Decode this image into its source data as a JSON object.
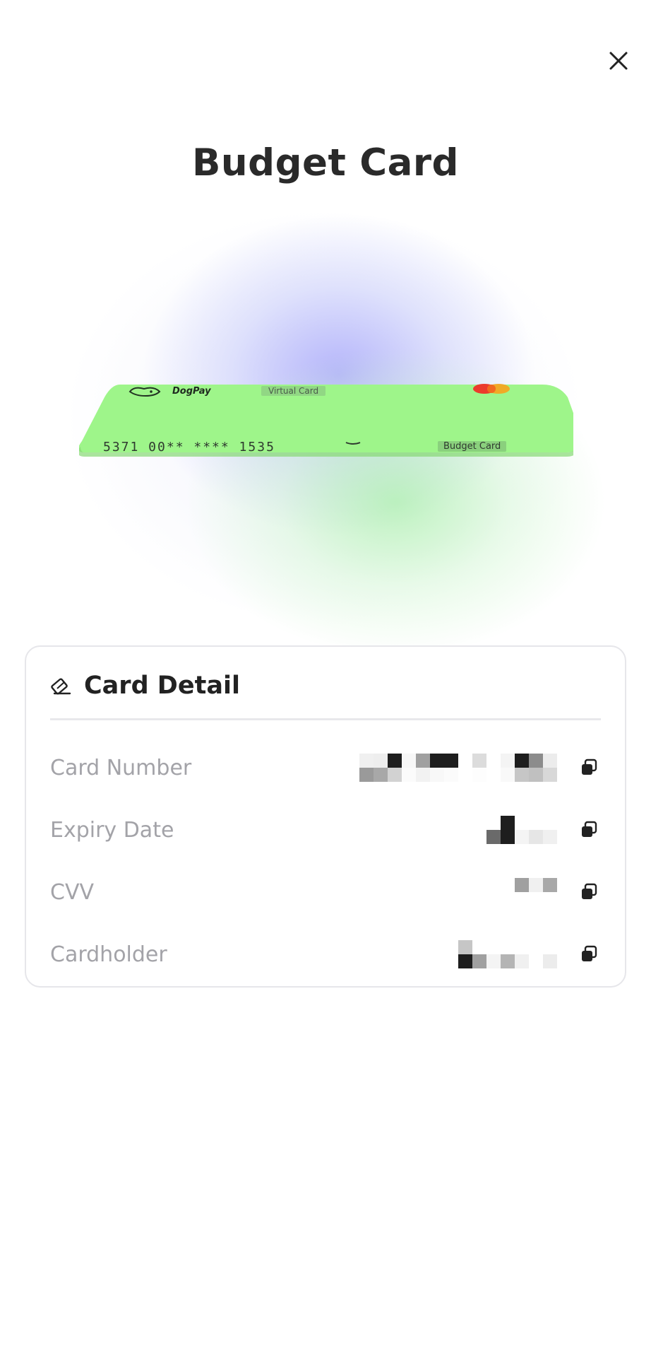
{
  "header": {
    "close_icon": "close-icon",
    "title": "Budget Card"
  },
  "card": {
    "brand": "DogPay",
    "type_label": "Virtual Card",
    "number": "5371 00** **** 1535",
    "name": "Budget Card",
    "network_icon": "mastercard-logo",
    "color": "#9ef58a"
  },
  "detail": {
    "title": "Card Detail",
    "title_icon": "edit-card-icon",
    "rows": [
      {
        "label": "Card Number",
        "value_masked": true,
        "copy_icon": "copy-icon"
      },
      {
        "label": "Expiry Date",
        "value_masked": true,
        "copy_icon": "copy-icon"
      },
      {
        "label": "CVV",
        "value_masked": true,
        "copy_icon": "copy-icon"
      },
      {
        "label": "Cardholder",
        "value_masked": true,
        "copy_icon": "copy-icon"
      }
    ]
  },
  "colors": {
    "accent_green": "#9ef58a",
    "glow_purple": "#aaaafa",
    "label_gray": "#a3a3a8"
  }
}
